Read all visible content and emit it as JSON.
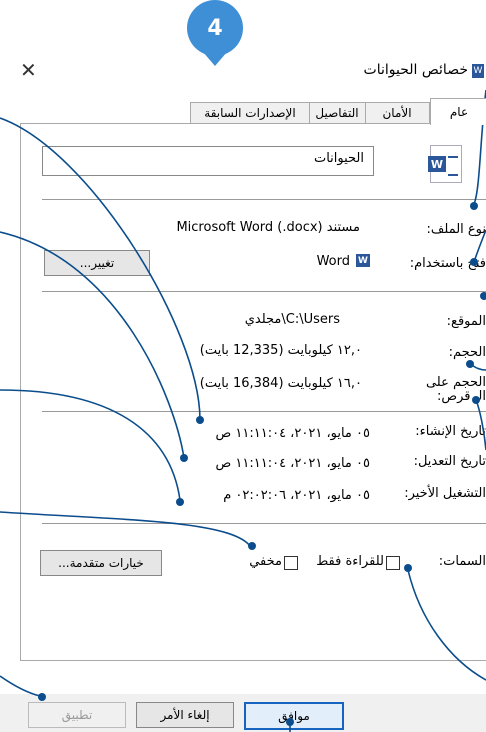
{
  "badge": "4",
  "window": {
    "title": "خصائص الحيوانات"
  },
  "tabs": [
    {
      "label": "عام"
    },
    {
      "label": "الأمان"
    },
    {
      "label": "التفاصيل"
    },
    {
      "label": "الإصدارات السابقة"
    }
  ],
  "general": {
    "file_name": "الحيوانات",
    "file_type_label": "نوع الملف:",
    "file_type_value": "مستند Microsoft Word (.docx)",
    "opens_with_label": "فتح باستخدام:",
    "opens_with_value": "Word",
    "change_button": "تغيير...",
    "location_label": "الموقع:",
    "location_value": "C:\\Users\\مجلدي",
    "size_label": "الحجم:",
    "size_value": "١٢,٠ كيلوبايت (12,335 بايت)",
    "size_on_disk_label": "الحجم على الـ قرص:",
    "size_on_disk_value": "١٦,٠ كيلوبايت (16,384 بايت)",
    "created_label": "تاريخ الإنشاء:",
    "created_value": "٠٥ مايو، ٢٠٢١، ١١:١١:٠٤ ص",
    "modified_label": "تاريخ التعديل:",
    "modified_value": "٠٥ مايو، ٢٠٢١، ١١:١١:٠٤ ص",
    "accessed_label": "التشغيل الأخير:",
    "accessed_value": "٠٥ مايو، ٢٠٢١، ٠٢:٠٢:٠٦ م",
    "attributes_label": "السمات:",
    "readonly_label": "للقراءة فقط",
    "hidden_label": "مخفي",
    "advanced_button": "خيارات متقدمة..."
  },
  "footer": {
    "ok": "موافق",
    "cancel": "إلغاء الأمر",
    "apply": "تطبيق"
  },
  "colors": {
    "accent": "#1565c0",
    "badge": "#3e8fd6",
    "annotation": "#0b4d8c"
  }
}
